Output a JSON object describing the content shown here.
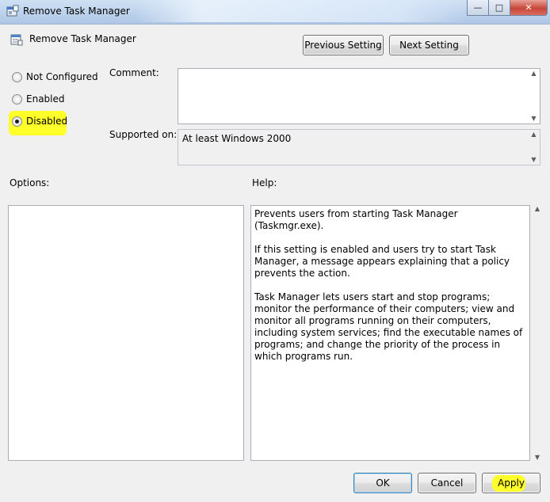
{
  "window": {
    "title": "Remove Task Manager",
    "controls": {
      "minimize": "—",
      "maximize": "□",
      "close": "✕"
    }
  },
  "header": {
    "title": "Remove Task Manager",
    "previous_label": "Previous Setting",
    "next_label": "Next Setting"
  },
  "state": {
    "options": [
      {
        "label": "Not Configured",
        "selected": false
      },
      {
        "label": "Enabled",
        "selected": false
      },
      {
        "label": "Disabled",
        "selected": true
      }
    ]
  },
  "comment": {
    "label": "Comment:",
    "value": ""
  },
  "supported": {
    "label": "Supported on:",
    "value": "At least Windows 2000"
  },
  "options_panel": {
    "label": "Options:"
  },
  "help_panel": {
    "label": "Help:",
    "paragraphs": [
      "Prevents users from starting Task Manager (Taskmgr.exe).",
      "If this setting is enabled and users try to start Task Manager, a message appears explaining that a policy prevents the action.",
      "Task Manager lets users start and stop programs; monitor the performance of their computers; view and monitor all programs running on their computers, including system services; find the executable names of programs; and change the priority of the process in which programs run."
    ]
  },
  "footer": {
    "ok_label": "OK",
    "cancel_label": "Cancel",
    "apply_label": "Apply"
  },
  "colors": {
    "highlight": "#ffff2a",
    "title_bar": "#bcd2ec"
  }
}
